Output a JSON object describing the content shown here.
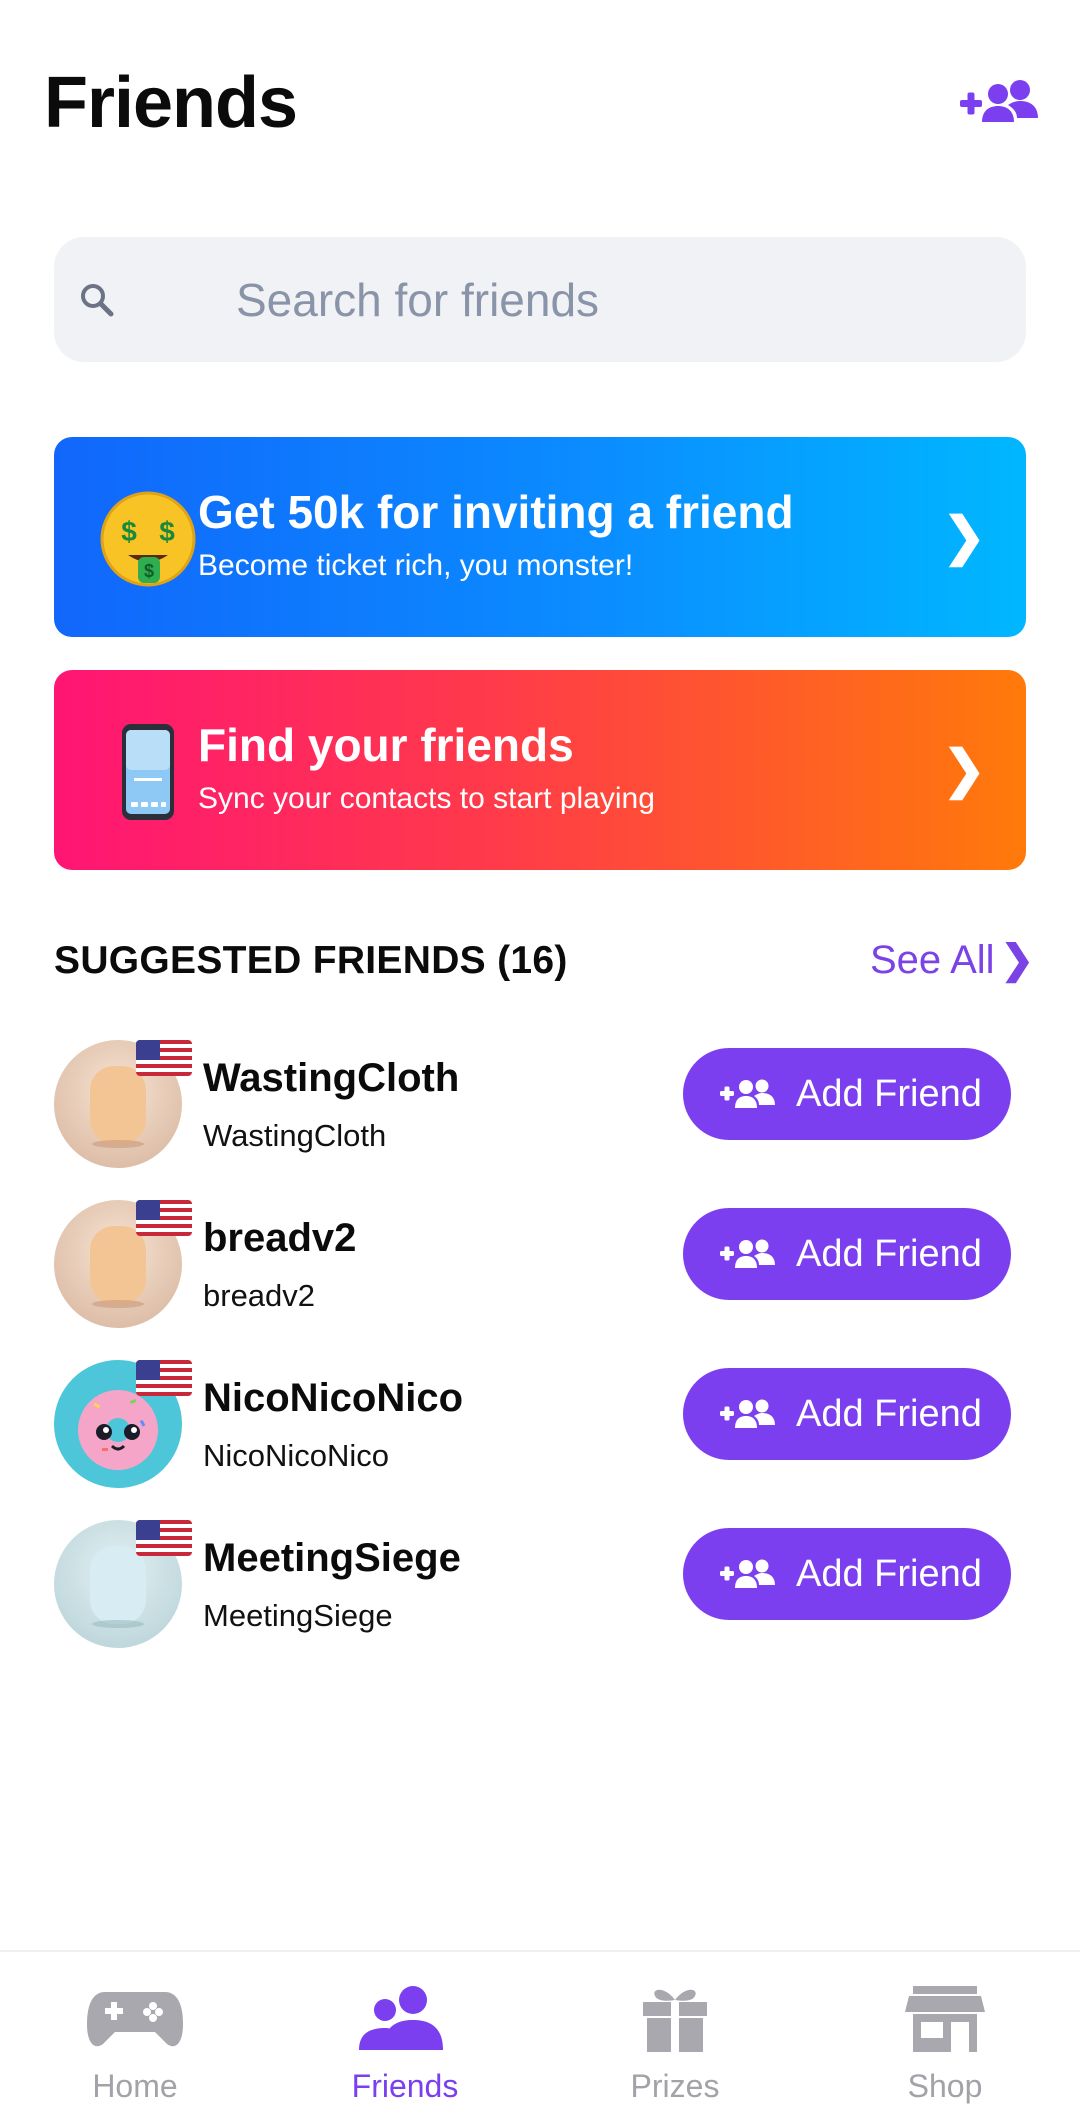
{
  "header": {
    "title": "Friends",
    "add_icon": "add-friends-icon",
    "accent": "#7b3ff0"
  },
  "search": {
    "placeholder": "Search for friends",
    "value": ""
  },
  "promos": [
    {
      "title": "Get 50k for inviting a friend",
      "subtitle": "Become ticket rich, you monster!",
      "icon": "money-face-emoji",
      "colors": [
        "#1167fb",
        "#00b7ff"
      ]
    },
    {
      "title": "Find your friends",
      "subtitle": "Sync your contacts to start playing",
      "icon": "phone-icon",
      "colors": [
        "#ff1574",
        "#ff7a0a"
      ]
    }
  ],
  "suggested": {
    "title": "SUGGESTED FRIENDS (16)",
    "see_all": "See All",
    "see_all_chevron": "❯",
    "friends": [
      {
        "name": "WastingCloth",
        "handle": "WastingCloth",
        "flag": "us-flag",
        "button": "Add Friend"
      },
      {
        "name": "breadv2",
        "handle": "breadv2",
        "flag": "us-flag",
        "button": "Add Friend"
      },
      {
        "name": "NicoNicoNico",
        "handle": "NicoNicoNico",
        "flag": "us-flag",
        "button": "Add Friend"
      },
      {
        "name": "MeetingSiege",
        "handle": "MeetingSiege",
        "flag": "us-flag",
        "button": "Add Friend"
      }
    ]
  },
  "nav": {
    "items": [
      {
        "label": "Home",
        "icon": "gamepad-icon"
      },
      {
        "label": "Friends",
        "icon": "friends-icon",
        "active": true
      },
      {
        "label": "Prizes",
        "icon": "gift-icon"
      },
      {
        "label": "Shop",
        "icon": "shop-icon"
      }
    ]
  },
  "chevron": "❯"
}
